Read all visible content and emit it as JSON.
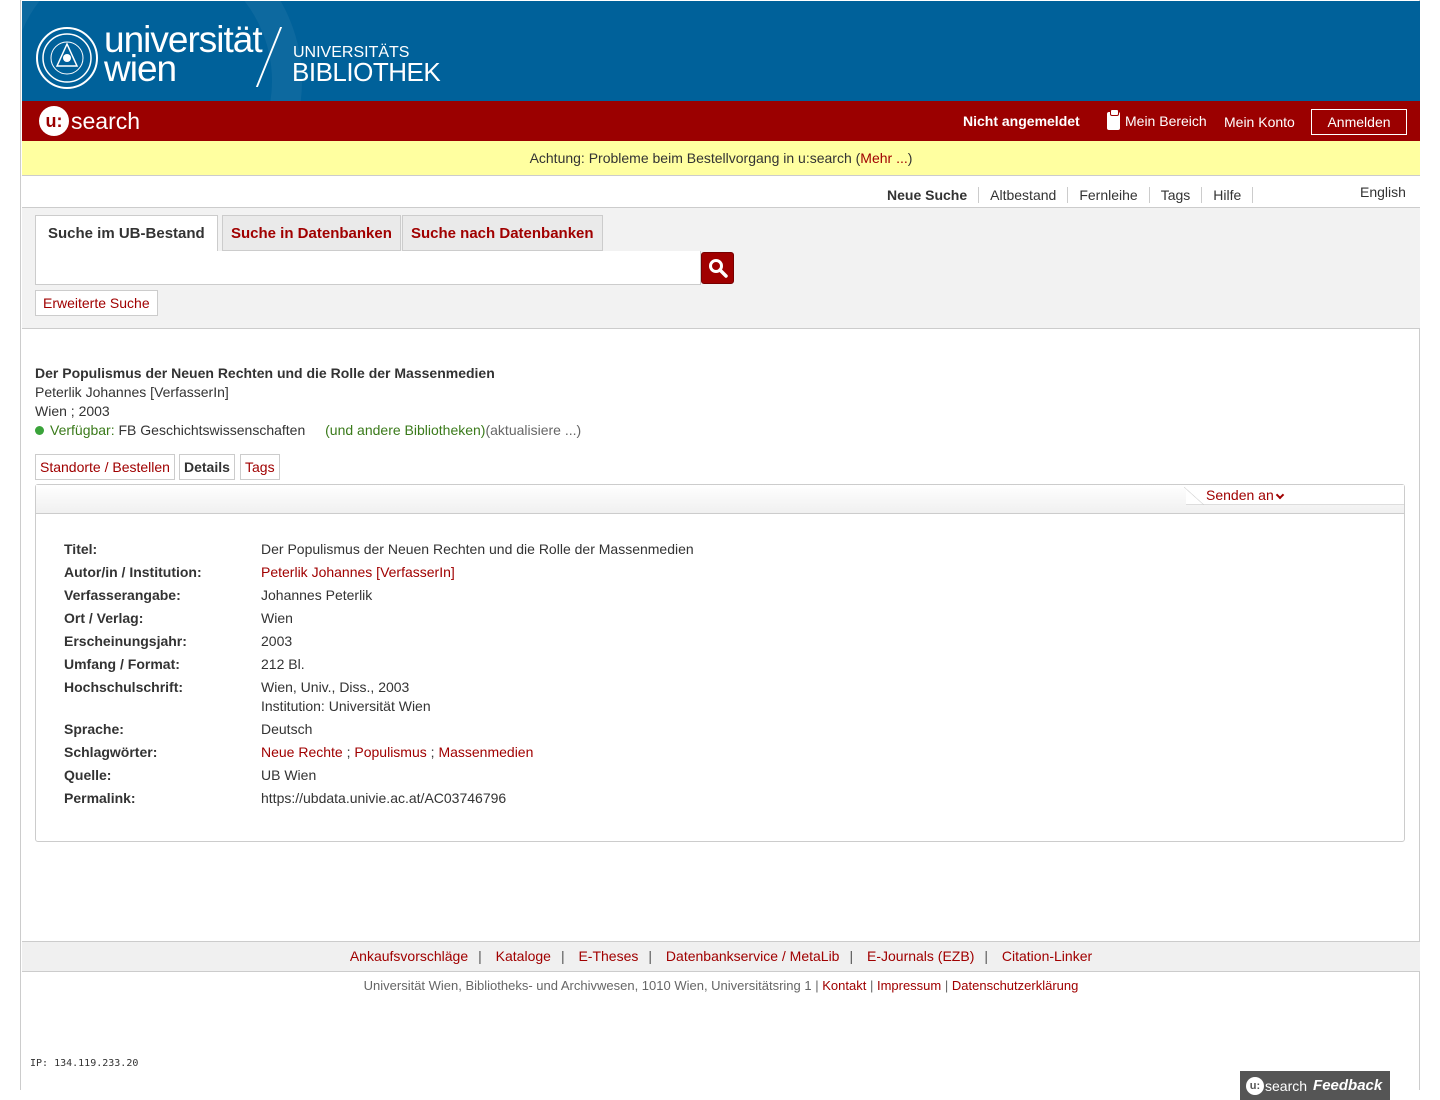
{
  "header": {
    "logo_uni_line1": "universität",
    "logo_uni_line2": "wien",
    "logo_ub_line1": "UNIVERSITÄTS",
    "logo_ub_line2": "BIBLIOTHEK"
  },
  "userbar": {
    "logo_prefix": "u:",
    "logo_word": "search",
    "status": "Nicht angemeldet",
    "mein_bereich": "Mein Bereich",
    "mein_konto": "Mein Konto",
    "anmelden": "Anmelden"
  },
  "notice": {
    "text": "Achtung: Probleme beim Bestellvorgang in u:search (",
    "link": "Mehr ...",
    "close": ")"
  },
  "topnav": {
    "items": [
      "Neue Suche",
      "Altbestand",
      "Fernleihe",
      "Tags",
      "Hilfe"
    ],
    "language": "English"
  },
  "search": {
    "tabs": [
      "Suche im UB-Bestand",
      "Suche in Datenbanken",
      "Suche nach Datenbanken"
    ],
    "input_value": "",
    "advanced": "Erweiterte Suche"
  },
  "record": {
    "title": "Der Populismus der Neuen Rechten und die Rolle der Massenmedien",
    "author": "Peterlik Johannes [VerfasserIn]",
    "pub": "Wien ; 2003",
    "avail_label": "Verfügbar:",
    "avail_location": " FB Geschichtswissenschaften",
    "avail_others": "(und andere Bibliotheken)",
    "avail_refresh": "(aktualisiere ...)",
    "tabs": [
      "Standorte / Bestellen",
      "Details",
      "Tags"
    ],
    "send_to": "Senden an"
  },
  "details": {
    "titel_label": "Titel:",
    "titel": "Der Populismus der Neuen Rechten und die Rolle der Massenmedien",
    "autor_label": "Autor/in / Institution:",
    "autor": "Peterlik Johannes [VerfasserIn]",
    "verf_label": "Verfasserangabe:",
    "verf": "Johannes Peterlik",
    "ort_label": "Ort / Verlag:",
    "ort": "Wien",
    "jahr_label": "Erscheinungsjahr:",
    "jahr": "2003",
    "umfang_label": "Umfang / Format:",
    "umfang": "212 Bl.",
    "hs_label": "Hochschulschrift:",
    "hs_line1": "Wien, Univ., Diss., 2003",
    "hs_line2": "Institution: Universität Wien",
    "sprache_label": "Sprache:",
    "sprache": "Deutsch",
    "schlag_label": "Schlagwörter:",
    "schlag": [
      "Neue Rechte",
      "Populismus",
      "Massenmedien"
    ],
    "schlag_sep": ";",
    "quelle_label": "Quelle:",
    "quelle": "UB Wien",
    "perma_label": "Permalink:",
    "perma": "https://ubdata.univie.ac.at/AC03746796"
  },
  "footer": {
    "links": [
      "Ankaufsvorschläge",
      "Kataloge",
      "E-Theses",
      "Datenbankservice / MetaLib",
      "E-Journals (EZB)",
      "Citation-Linker"
    ],
    "separator": "|",
    "address": "Universität Wien, Bibliotheks- und Archivwesen, 1010 Wien, Universitätsring 1 |",
    "kontakt": "Kontakt",
    "impressum": "Impressum",
    "datenschutz": "Datenschutzerklärung",
    "ip": "IP: 134.119.233.20",
    "feedback_prefix": "u:",
    "feedback_word": "search",
    "feedback_bold": "Feedback"
  },
  "colors": {
    "header_blue": "#00619a",
    "usearch_red": "#9b0000",
    "notice_yellow": "#ffffa0",
    "link_red": "#a00000",
    "available_green": "#3aa33a"
  }
}
